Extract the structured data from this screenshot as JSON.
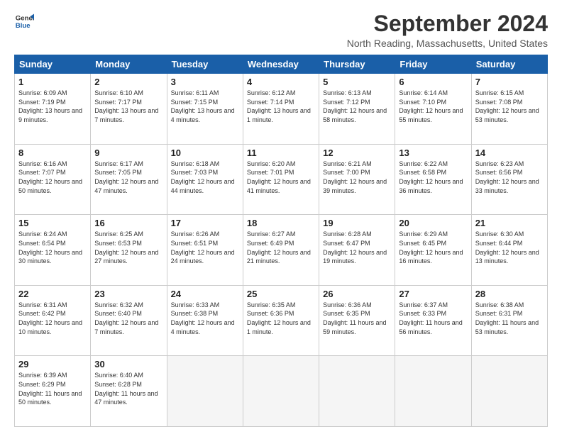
{
  "logo": {
    "line1": "General",
    "line2": "Blue"
  },
  "title": "September 2024",
  "location": "North Reading, Massachusetts, United States",
  "days_of_week": [
    "Sunday",
    "Monday",
    "Tuesday",
    "Wednesday",
    "Thursday",
    "Friday",
    "Saturday"
  ],
  "weeks": [
    [
      {
        "day": "1",
        "sunrise": "6:09 AM",
        "sunset": "7:19 PM",
        "daylight": "13 hours and 9 minutes."
      },
      {
        "day": "2",
        "sunrise": "6:10 AM",
        "sunset": "7:17 PM",
        "daylight": "13 hours and 7 minutes."
      },
      {
        "day": "3",
        "sunrise": "6:11 AM",
        "sunset": "7:15 PM",
        "daylight": "13 hours and 4 minutes."
      },
      {
        "day": "4",
        "sunrise": "6:12 AM",
        "sunset": "7:14 PM",
        "daylight": "13 hours and 1 minute."
      },
      {
        "day": "5",
        "sunrise": "6:13 AM",
        "sunset": "7:12 PM",
        "daylight": "12 hours and 58 minutes."
      },
      {
        "day": "6",
        "sunrise": "6:14 AM",
        "sunset": "7:10 PM",
        "daylight": "12 hours and 55 minutes."
      },
      {
        "day": "7",
        "sunrise": "6:15 AM",
        "sunset": "7:08 PM",
        "daylight": "12 hours and 53 minutes."
      }
    ],
    [
      {
        "day": "8",
        "sunrise": "6:16 AM",
        "sunset": "7:07 PM",
        "daylight": "12 hours and 50 minutes."
      },
      {
        "day": "9",
        "sunrise": "6:17 AM",
        "sunset": "7:05 PM",
        "daylight": "12 hours and 47 minutes."
      },
      {
        "day": "10",
        "sunrise": "6:18 AM",
        "sunset": "7:03 PM",
        "daylight": "12 hours and 44 minutes."
      },
      {
        "day": "11",
        "sunrise": "6:20 AM",
        "sunset": "7:01 PM",
        "daylight": "12 hours and 41 minutes."
      },
      {
        "day": "12",
        "sunrise": "6:21 AM",
        "sunset": "7:00 PM",
        "daylight": "12 hours and 39 minutes."
      },
      {
        "day": "13",
        "sunrise": "6:22 AM",
        "sunset": "6:58 PM",
        "daylight": "12 hours and 36 minutes."
      },
      {
        "day": "14",
        "sunrise": "6:23 AM",
        "sunset": "6:56 PM",
        "daylight": "12 hours and 33 minutes."
      }
    ],
    [
      {
        "day": "15",
        "sunrise": "6:24 AM",
        "sunset": "6:54 PM",
        "daylight": "12 hours and 30 minutes."
      },
      {
        "day": "16",
        "sunrise": "6:25 AM",
        "sunset": "6:53 PM",
        "daylight": "12 hours and 27 minutes."
      },
      {
        "day": "17",
        "sunrise": "6:26 AM",
        "sunset": "6:51 PM",
        "daylight": "12 hours and 24 minutes."
      },
      {
        "day": "18",
        "sunrise": "6:27 AM",
        "sunset": "6:49 PM",
        "daylight": "12 hours and 21 minutes."
      },
      {
        "day": "19",
        "sunrise": "6:28 AM",
        "sunset": "6:47 PM",
        "daylight": "12 hours and 19 minutes."
      },
      {
        "day": "20",
        "sunrise": "6:29 AM",
        "sunset": "6:45 PM",
        "daylight": "12 hours and 16 minutes."
      },
      {
        "day": "21",
        "sunrise": "6:30 AM",
        "sunset": "6:44 PM",
        "daylight": "12 hours and 13 minutes."
      }
    ],
    [
      {
        "day": "22",
        "sunrise": "6:31 AM",
        "sunset": "6:42 PM",
        "daylight": "12 hours and 10 minutes."
      },
      {
        "day": "23",
        "sunrise": "6:32 AM",
        "sunset": "6:40 PM",
        "daylight": "12 hours and 7 minutes."
      },
      {
        "day": "24",
        "sunrise": "6:33 AM",
        "sunset": "6:38 PM",
        "daylight": "12 hours and 4 minutes."
      },
      {
        "day": "25",
        "sunrise": "6:35 AM",
        "sunset": "6:36 PM",
        "daylight": "12 hours and 1 minute."
      },
      {
        "day": "26",
        "sunrise": "6:36 AM",
        "sunset": "6:35 PM",
        "daylight": "11 hours and 59 minutes."
      },
      {
        "day": "27",
        "sunrise": "6:37 AM",
        "sunset": "6:33 PM",
        "daylight": "11 hours and 56 minutes."
      },
      {
        "day": "28",
        "sunrise": "6:38 AM",
        "sunset": "6:31 PM",
        "daylight": "11 hours and 53 minutes."
      }
    ],
    [
      {
        "day": "29",
        "sunrise": "6:39 AM",
        "sunset": "6:29 PM",
        "daylight": "11 hours and 50 minutes."
      },
      {
        "day": "30",
        "sunrise": "6:40 AM",
        "sunset": "6:28 PM",
        "daylight": "11 hours and 47 minutes."
      },
      null,
      null,
      null,
      null,
      null
    ]
  ]
}
